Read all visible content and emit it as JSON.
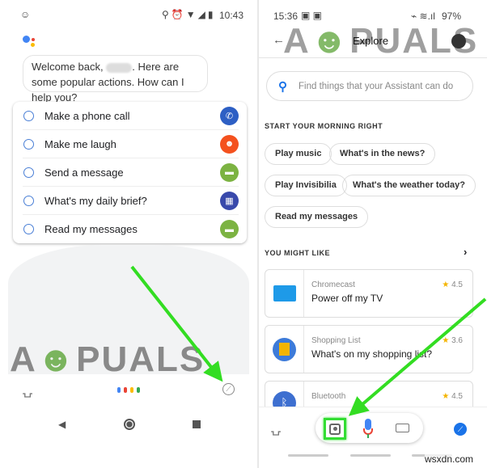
{
  "left": {
    "status": {
      "time": "10:43"
    },
    "greeting": {
      "part1": "Welcome back, ",
      "part2": ". Here are some popular actions. How can I help you?"
    },
    "actions": [
      {
        "label": "Make a phone call",
        "icon": "phone-icon",
        "color": "#2d5fc4"
      },
      {
        "label": "Make me laugh",
        "icon": "sticker-icon",
        "color": "#f4511e"
      },
      {
        "label": "Send a message",
        "icon": "message-icon",
        "color": "#7cb342"
      },
      {
        "label": "What's my daily brief?",
        "icon": "calendar-icon",
        "color": "#3949ab"
      },
      {
        "label": "Read my messages",
        "icon": "message-icon",
        "color": "#7cb342"
      }
    ],
    "watermark": "A PUALS"
  },
  "right": {
    "status": {
      "time": "15:36",
      "battery": "97%"
    },
    "header": {
      "title": "Explore"
    },
    "search": {
      "placeholder": "Find things that your Assistant can do"
    },
    "morning": {
      "title": "START YOUR MORNING RIGHT",
      "chips": [
        "Play music",
        "What's in the news?",
        "Play Invisibilia",
        "What's the weather today?",
        "Read my messages"
      ]
    },
    "might_like": {
      "title": "YOU MIGHT LIKE",
      "cards": [
        {
          "provider": "Chromecast",
          "action": "Power off my TV",
          "rating": "4.5"
        },
        {
          "provider": "Shopping List",
          "action": "What's on my shopping list?",
          "rating": "3.6"
        },
        {
          "provider": "Bluetooth",
          "action": "",
          "rating": "4.5"
        }
      ]
    },
    "watermark": "A PUALS"
  },
  "site_watermark": "wsxdn.com",
  "colors": {
    "annotation_arrow": "#33dd22",
    "accent": "#1a73e8"
  }
}
